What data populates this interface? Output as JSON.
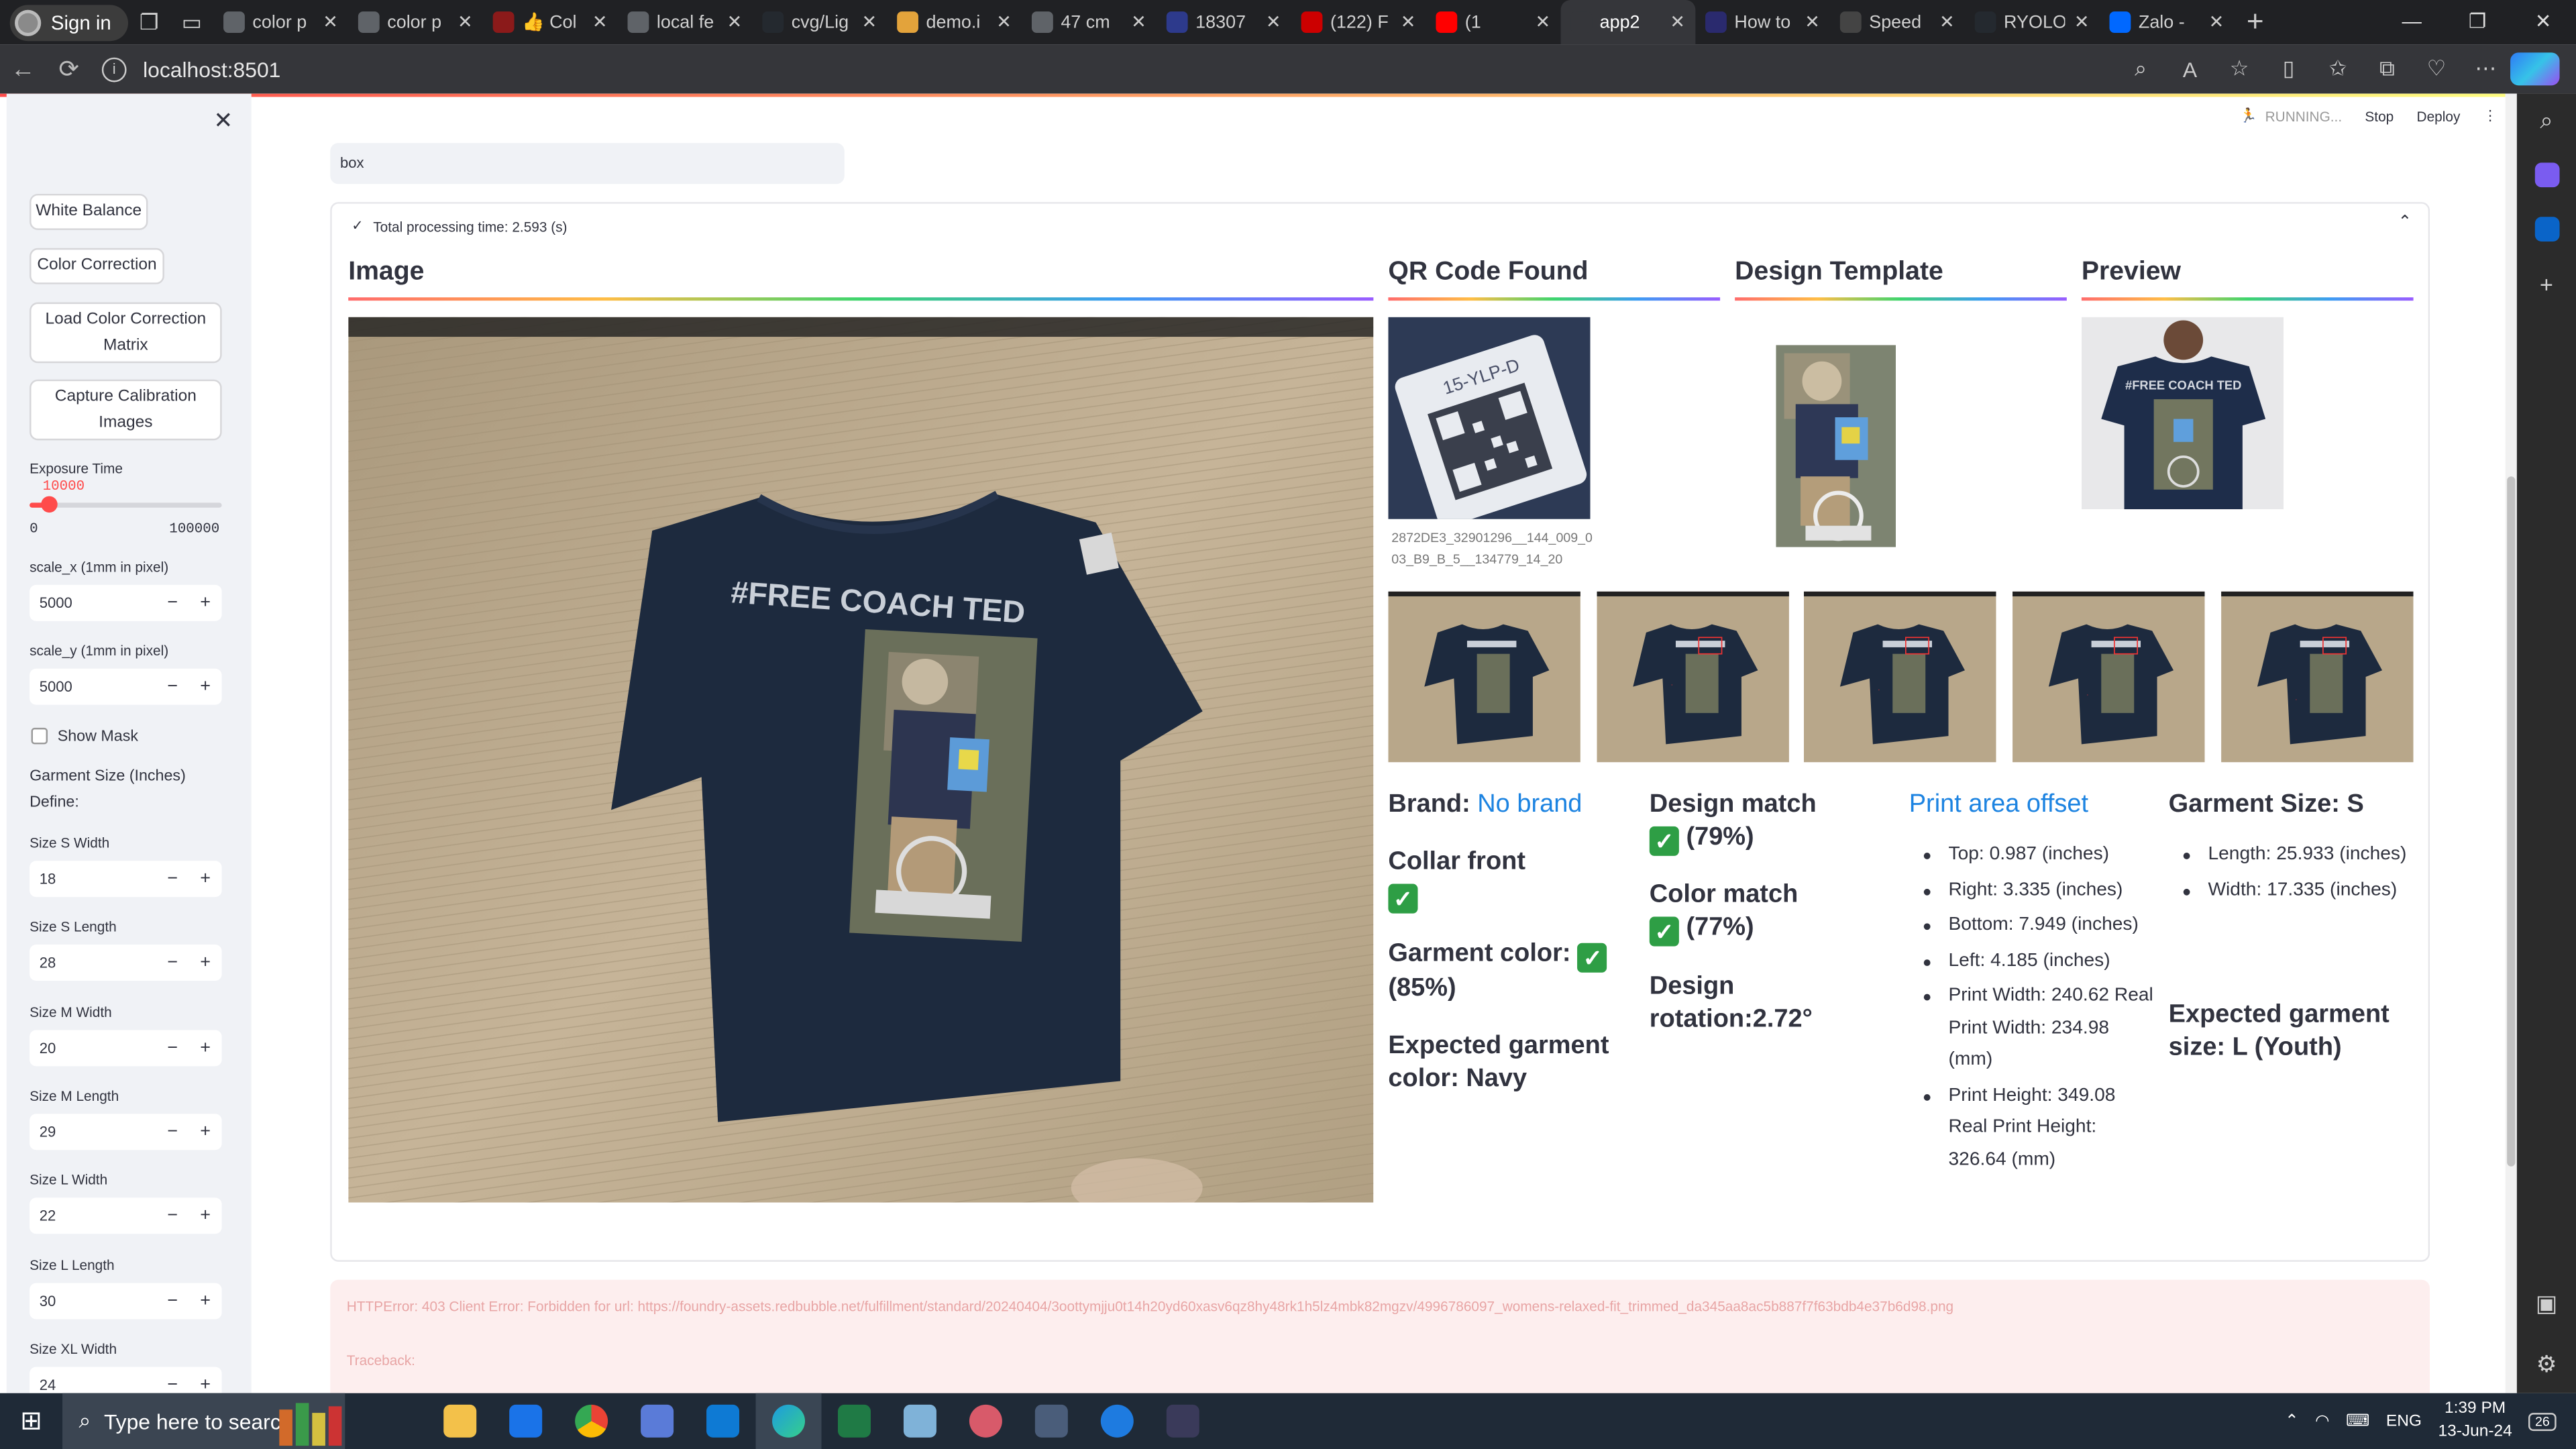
{
  "browser": {
    "signin_label": "Sign in",
    "tabs": [
      {
        "title": "color p",
        "color": "#5f6368"
      },
      {
        "title": "color p",
        "color": "#5f6368"
      },
      {
        "title": "👍 Col",
        "color": "#8b1a1a"
      },
      {
        "title": "local fe",
        "color": "#5f6368"
      },
      {
        "title": "cvg/Lig",
        "color": "#24292f"
      },
      {
        "title": "demo.i",
        "color": "#e3a33b"
      },
      {
        "title": "47 cm",
        "color": "#5f6368"
      },
      {
        "title": "18307",
        "color": "#2d3a8c"
      },
      {
        "title": "(122) F",
        "color": "#cc0000"
      },
      {
        "title": "(1",
        "color": "#ff0000"
      },
      {
        "title": "app2",
        "color": "#35363a"
      },
      {
        "title": "How to",
        "color": "#2a2a6e"
      },
      {
        "title": "Speed",
        "color": "#444"
      },
      {
        "title": "RYOLO",
        "color": "#24292f"
      },
      {
        "title": "Zalo -",
        "color": "#0068ff"
      }
    ],
    "active_tab": 10,
    "url": "localhost:8501"
  },
  "app_status": {
    "running": "RUNNING...",
    "stop": "Stop",
    "deploy": "Deploy"
  },
  "sidebar": {
    "buttons": {
      "white_balance": "White Balance",
      "color_correction": "Color Correction",
      "load_ccm": "Load Color Correction Matrix",
      "capture": "Capture Calibration Images"
    },
    "exposure": {
      "label": "Exposure Time",
      "value": "10000",
      "min": "0",
      "max": "100000",
      "fraction": 0.1
    },
    "scale_x": {
      "label": "scale_x (1mm in pixel)",
      "value": "5000"
    },
    "scale_y": {
      "label": "scale_y (1mm in pixel)",
      "value": "5000"
    },
    "show_mask": "Show Mask",
    "garment_size_label": "Garment Size (Inches)",
    "define_label": "Define:",
    "sizes": [
      {
        "label": "Size S Width",
        "value": "18"
      },
      {
        "label": "Size S Length",
        "value": "28"
      },
      {
        "label": "Size M Width",
        "value": "20"
      },
      {
        "label": "Size M Length",
        "value": "29"
      },
      {
        "label": "Size L Width",
        "value": "22"
      },
      {
        "label": "Size L Length",
        "value": "30"
      },
      {
        "label": "Size XL Width",
        "value": "24"
      }
    ],
    "minus": "−",
    "plus": "+"
  },
  "main": {
    "search_value": "box",
    "processing": "Total processing time: 2.593 (s)",
    "headers": {
      "image": "Image",
      "qr": "QR Code Found",
      "template": "Design Template",
      "preview": "Preview"
    },
    "qr_label": "15-YLP-D",
    "qr_caption": "2872DE3_32901296__144_009_003_B9_B_5__134779_14_20",
    "shirt_text": "#FREE COACH TED",
    "brand_label": "Brand: ",
    "brand_value": "No brand",
    "collar": "Collar front",
    "garment_color": "Garment color:",
    "garment_color_pct": "(85%)",
    "expected_color": "Expected garment color: Navy",
    "design_match": "Design match",
    "design_match_pct": "(79%)",
    "color_match": "Color match",
    "color_match_pct": "(77%)",
    "design_rotation": "Design rotation:2.72°",
    "offset_title": "Print area offset",
    "offset_items": [
      "Top: 0.987 (inches)",
      "Right: 3.335 (inches)",
      "Bottom: 7.949 (inches)",
      "Left: 4.185 (inches)",
      "Print Width: 240.62 Real Print Width: 234.98 (mm)",
      "Print Height: 349.08 Real Print Height: 326.64 (mm)"
    ],
    "garment_size_title": "Garment Size: S",
    "size_items": [
      "Length: 25.933 (inches)",
      "Width: 17.335 (inches)"
    ],
    "expected_size": "Expected garment size: L (Youth)",
    "check": "✓"
  },
  "error": {
    "text": "HTTPError: 403 Client Error: Forbidden for url: https://foundry-assets.redbubble.net/fulfillment/standard/20240404/3oottymjju0t14h20yd60xasv6qz8hy48rk1h5lz4mbk82mgzv/4996786097_womens-relaxed-fit_trimmed_da345aa8ac5b887f7f63bdb4e37b6d98.png",
    "traceback": "Traceback:"
  },
  "taskbar": {
    "search_placeholder": "Type here to search",
    "lang": "ENG",
    "time": "1:39 PM",
    "date": "13-Jun-24",
    "notif": "26"
  },
  "colors": {
    "accent": "#ff4b4b",
    "link": "#1c83e1",
    "navy": "#1d2a3e",
    "table": "#b9a589"
  }
}
